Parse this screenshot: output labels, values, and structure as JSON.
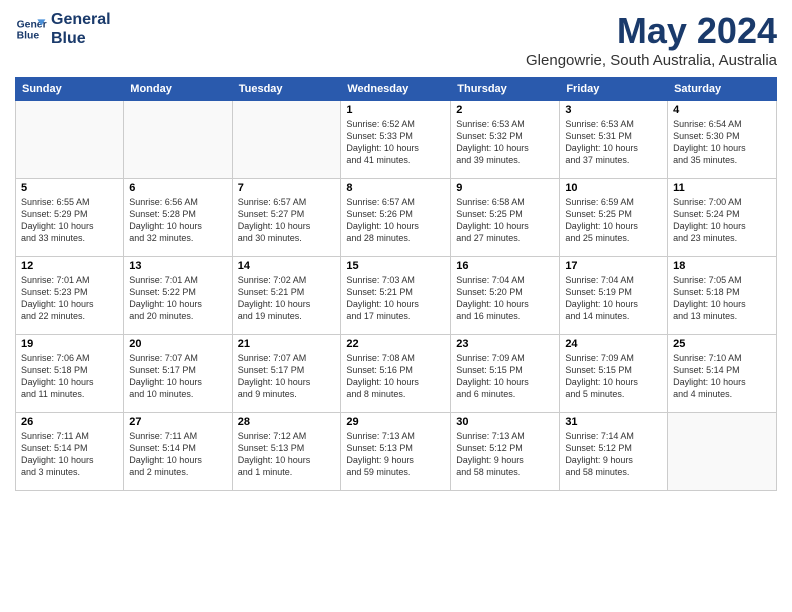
{
  "logo": {
    "line1": "General",
    "line2": "Blue"
  },
  "title": "May 2024",
  "subtitle": "Glengowrie, South Australia, Australia",
  "days_of_week": [
    "Sunday",
    "Monday",
    "Tuesday",
    "Wednesday",
    "Thursday",
    "Friday",
    "Saturday"
  ],
  "weeks": [
    [
      {
        "day": "",
        "info": ""
      },
      {
        "day": "",
        "info": ""
      },
      {
        "day": "",
        "info": ""
      },
      {
        "day": "1",
        "info": "Sunrise: 6:52 AM\nSunset: 5:33 PM\nDaylight: 10 hours\nand 41 minutes."
      },
      {
        "day": "2",
        "info": "Sunrise: 6:53 AM\nSunset: 5:32 PM\nDaylight: 10 hours\nand 39 minutes."
      },
      {
        "day": "3",
        "info": "Sunrise: 6:53 AM\nSunset: 5:31 PM\nDaylight: 10 hours\nand 37 minutes."
      },
      {
        "day": "4",
        "info": "Sunrise: 6:54 AM\nSunset: 5:30 PM\nDaylight: 10 hours\nand 35 minutes."
      }
    ],
    [
      {
        "day": "5",
        "info": "Sunrise: 6:55 AM\nSunset: 5:29 PM\nDaylight: 10 hours\nand 33 minutes."
      },
      {
        "day": "6",
        "info": "Sunrise: 6:56 AM\nSunset: 5:28 PM\nDaylight: 10 hours\nand 32 minutes."
      },
      {
        "day": "7",
        "info": "Sunrise: 6:57 AM\nSunset: 5:27 PM\nDaylight: 10 hours\nand 30 minutes."
      },
      {
        "day": "8",
        "info": "Sunrise: 6:57 AM\nSunset: 5:26 PM\nDaylight: 10 hours\nand 28 minutes."
      },
      {
        "day": "9",
        "info": "Sunrise: 6:58 AM\nSunset: 5:25 PM\nDaylight: 10 hours\nand 27 minutes."
      },
      {
        "day": "10",
        "info": "Sunrise: 6:59 AM\nSunset: 5:25 PM\nDaylight: 10 hours\nand 25 minutes."
      },
      {
        "day": "11",
        "info": "Sunrise: 7:00 AM\nSunset: 5:24 PM\nDaylight: 10 hours\nand 23 minutes."
      }
    ],
    [
      {
        "day": "12",
        "info": "Sunrise: 7:01 AM\nSunset: 5:23 PM\nDaylight: 10 hours\nand 22 minutes."
      },
      {
        "day": "13",
        "info": "Sunrise: 7:01 AM\nSunset: 5:22 PM\nDaylight: 10 hours\nand 20 minutes."
      },
      {
        "day": "14",
        "info": "Sunrise: 7:02 AM\nSunset: 5:21 PM\nDaylight: 10 hours\nand 19 minutes."
      },
      {
        "day": "15",
        "info": "Sunrise: 7:03 AM\nSunset: 5:21 PM\nDaylight: 10 hours\nand 17 minutes."
      },
      {
        "day": "16",
        "info": "Sunrise: 7:04 AM\nSunset: 5:20 PM\nDaylight: 10 hours\nand 16 minutes."
      },
      {
        "day": "17",
        "info": "Sunrise: 7:04 AM\nSunset: 5:19 PM\nDaylight: 10 hours\nand 14 minutes."
      },
      {
        "day": "18",
        "info": "Sunrise: 7:05 AM\nSunset: 5:18 PM\nDaylight: 10 hours\nand 13 minutes."
      }
    ],
    [
      {
        "day": "19",
        "info": "Sunrise: 7:06 AM\nSunset: 5:18 PM\nDaylight: 10 hours\nand 11 minutes."
      },
      {
        "day": "20",
        "info": "Sunrise: 7:07 AM\nSunset: 5:17 PM\nDaylight: 10 hours\nand 10 minutes."
      },
      {
        "day": "21",
        "info": "Sunrise: 7:07 AM\nSunset: 5:17 PM\nDaylight: 10 hours\nand 9 minutes."
      },
      {
        "day": "22",
        "info": "Sunrise: 7:08 AM\nSunset: 5:16 PM\nDaylight: 10 hours\nand 8 minutes."
      },
      {
        "day": "23",
        "info": "Sunrise: 7:09 AM\nSunset: 5:15 PM\nDaylight: 10 hours\nand 6 minutes."
      },
      {
        "day": "24",
        "info": "Sunrise: 7:09 AM\nSunset: 5:15 PM\nDaylight: 10 hours\nand 5 minutes."
      },
      {
        "day": "25",
        "info": "Sunrise: 7:10 AM\nSunset: 5:14 PM\nDaylight: 10 hours\nand 4 minutes."
      }
    ],
    [
      {
        "day": "26",
        "info": "Sunrise: 7:11 AM\nSunset: 5:14 PM\nDaylight: 10 hours\nand 3 minutes."
      },
      {
        "day": "27",
        "info": "Sunrise: 7:11 AM\nSunset: 5:14 PM\nDaylight: 10 hours\nand 2 minutes."
      },
      {
        "day": "28",
        "info": "Sunrise: 7:12 AM\nSunset: 5:13 PM\nDaylight: 10 hours\nand 1 minute."
      },
      {
        "day": "29",
        "info": "Sunrise: 7:13 AM\nSunset: 5:13 PM\nDaylight: 9 hours\nand 59 minutes."
      },
      {
        "day": "30",
        "info": "Sunrise: 7:13 AM\nSunset: 5:12 PM\nDaylight: 9 hours\nand 58 minutes."
      },
      {
        "day": "31",
        "info": "Sunrise: 7:14 AM\nSunset: 5:12 PM\nDaylight: 9 hours\nand 58 minutes."
      },
      {
        "day": "",
        "info": ""
      }
    ]
  ]
}
